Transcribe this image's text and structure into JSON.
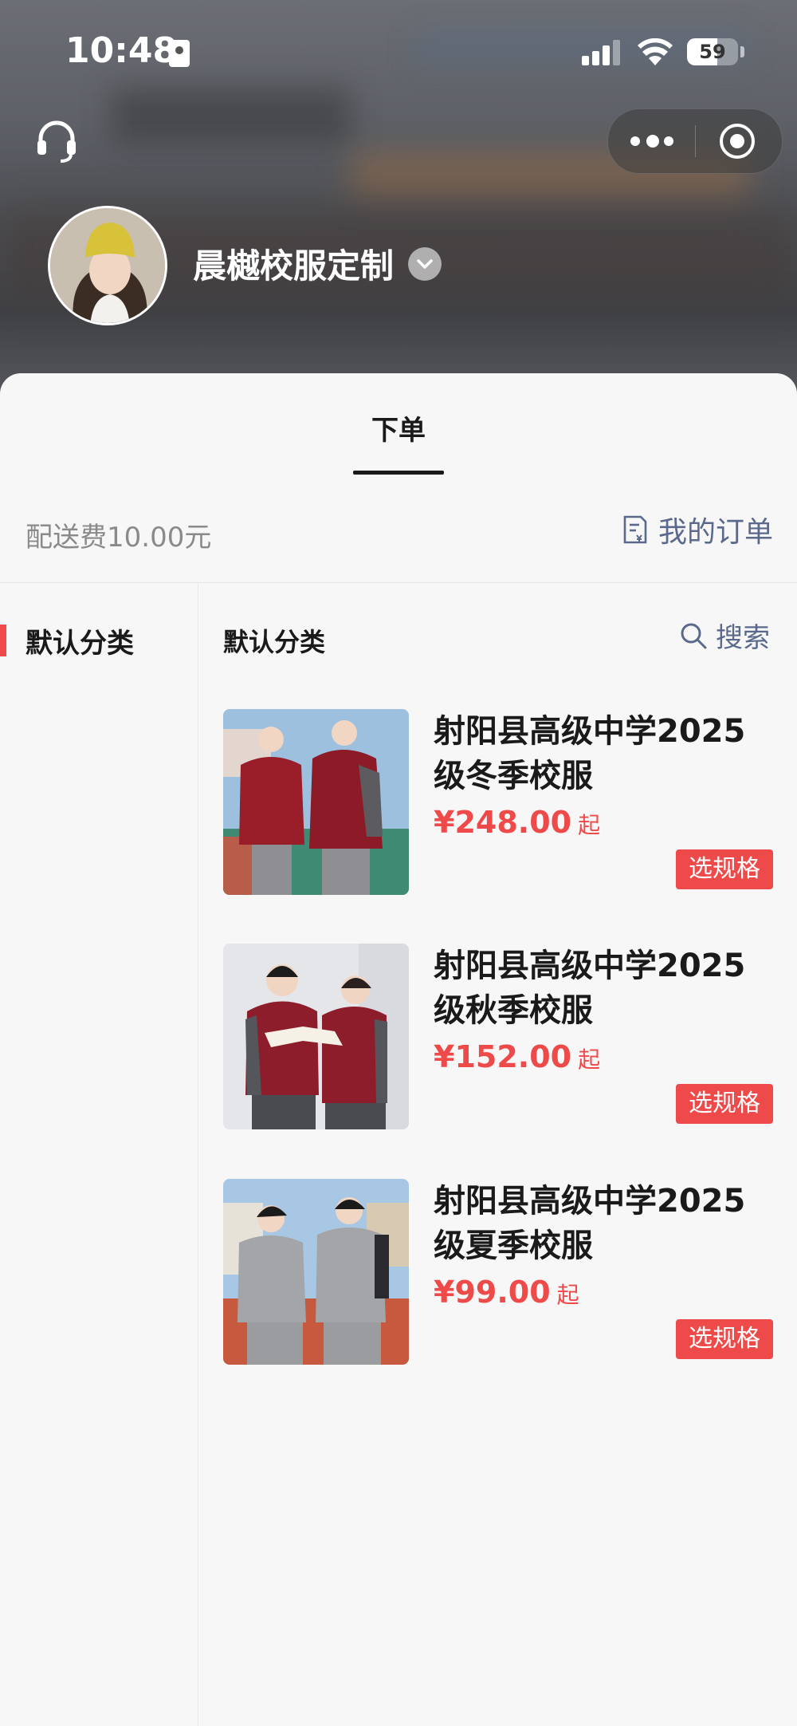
{
  "status_bar": {
    "time": "10:48",
    "battery": "59",
    "battery_level": 0.59
  },
  "header": {
    "shop_name": "晨樾校服定制"
  },
  "tabs": [
    {
      "label": "下单",
      "active": true
    }
  ],
  "info_bar": {
    "delivery_fee": "配送费10.00元",
    "my_orders_label": "我的订单"
  },
  "sidebar": {
    "items": [
      {
        "label": "默认分类",
        "active": true
      }
    ]
  },
  "content": {
    "category_title": "默认分类",
    "search_label": "搜索",
    "products": [
      {
        "name": "射阳县高级中学2025级冬季校服",
        "price": "¥248.00",
        "price_suffix": "起",
        "button": "选规格"
      },
      {
        "name": "射阳县高级中学2025级秋季校服",
        "price": "¥152.00",
        "price_suffix": "起",
        "button": "选规格"
      },
      {
        "name": "射阳县高级中学2025级夏季校服",
        "price": "¥99.00",
        "price_suffix": "起",
        "button": "选规格"
      }
    ]
  },
  "colors": {
    "accent": "#ee4a4a",
    "link": "#5b6a8c"
  }
}
